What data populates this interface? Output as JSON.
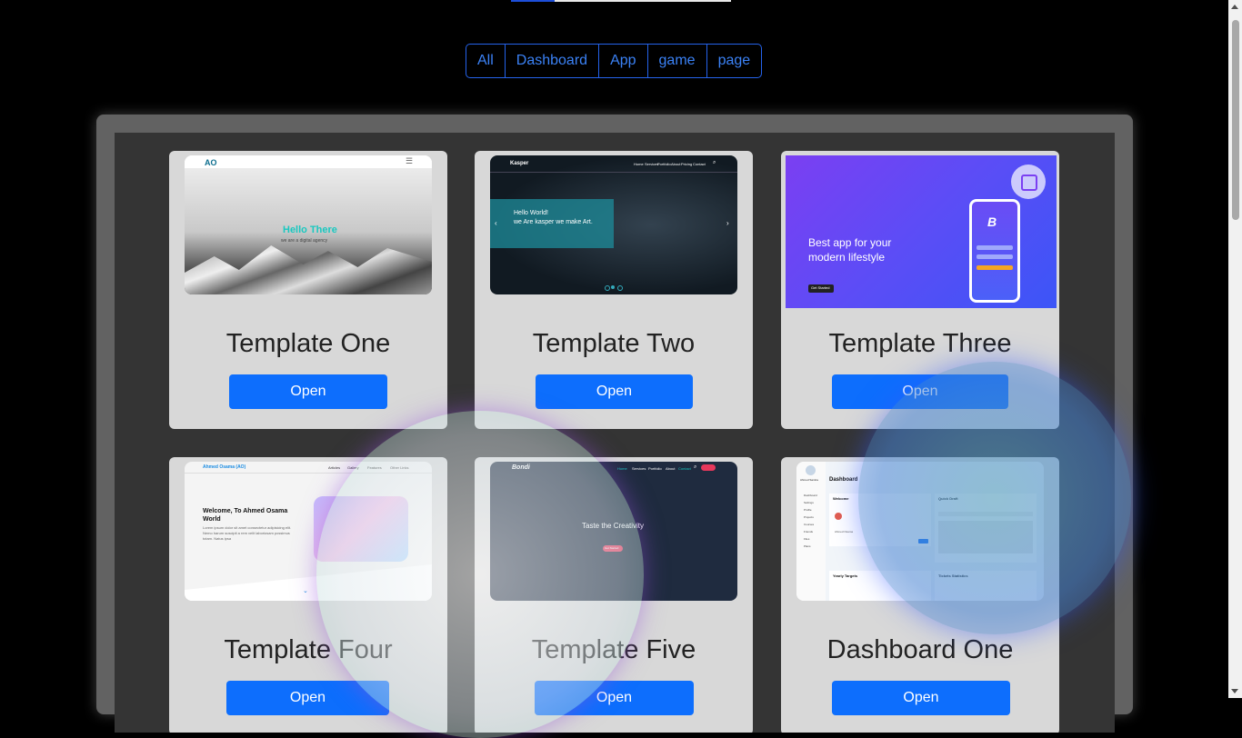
{
  "filters": [
    "All",
    "Dashboard",
    "App",
    "game",
    "page"
  ],
  "cards": [
    {
      "title": "Template One",
      "button": "Open",
      "thumb": {
        "logo": "AO",
        "headline": "Hello There",
        "subline": "we are a digital agency"
      }
    },
    {
      "title": "Template Two",
      "button": "Open",
      "thumb": {
        "logo": "Kasper",
        "nav": [
          "Home",
          "Services",
          "Portfolio",
          "About",
          "Pricing",
          "Contact"
        ],
        "headline1": "Hello World!",
        "headline2": "we Are kasper we make Art."
      }
    },
    {
      "title": "Template Three",
      "button": "Open",
      "thumb": {
        "headline": "Best app for your modern lifestyle",
        "cta": "Get Started",
        "app_letter": "B"
      }
    },
    {
      "title": "Template Four",
      "button": "Open",
      "thumb": {
        "logo": "Ahmed Osama (AO)",
        "nav": [
          "Articles",
          "Gallery",
          "Features",
          "Other Links"
        ],
        "headline": "Welcome, To Ahmed Osama World",
        "body": "Lorem ipsum dolor sit amet consectetur adipisicing elit. Nemo harum suscipit a rem velit laboriosam possimus totam. Natus ipsa"
      }
    },
    {
      "title": "Template Five",
      "button": "Open",
      "thumb": {
        "logo": "Bondi",
        "nav": [
          "Home",
          "Services",
          "Portfolio",
          "About",
          "Contact"
        ],
        "headline": "Taste the Creativity",
        "cta": "Get Started"
      }
    },
    {
      "title": "Dashboard One",
      "button": "Open",
      "thumb": {
        "user": "Ahmed Samira",
        "page_title": "Dashboard",
        "sidebar": [
          "Dashboard",
          "Settings",
          "Profile",
          "Projects",
          "Courses",
          "Friends",
          "Files",
          "Plans"
        ],
        "widget1": "Welcome",
        "widget2": "Quick Draft",
        "widget3": "Yearly Targets",
        "widget4": "Tickets Statistics",
        "profile_name": "Ahmed Osama"
      }
    }
  ]
}
